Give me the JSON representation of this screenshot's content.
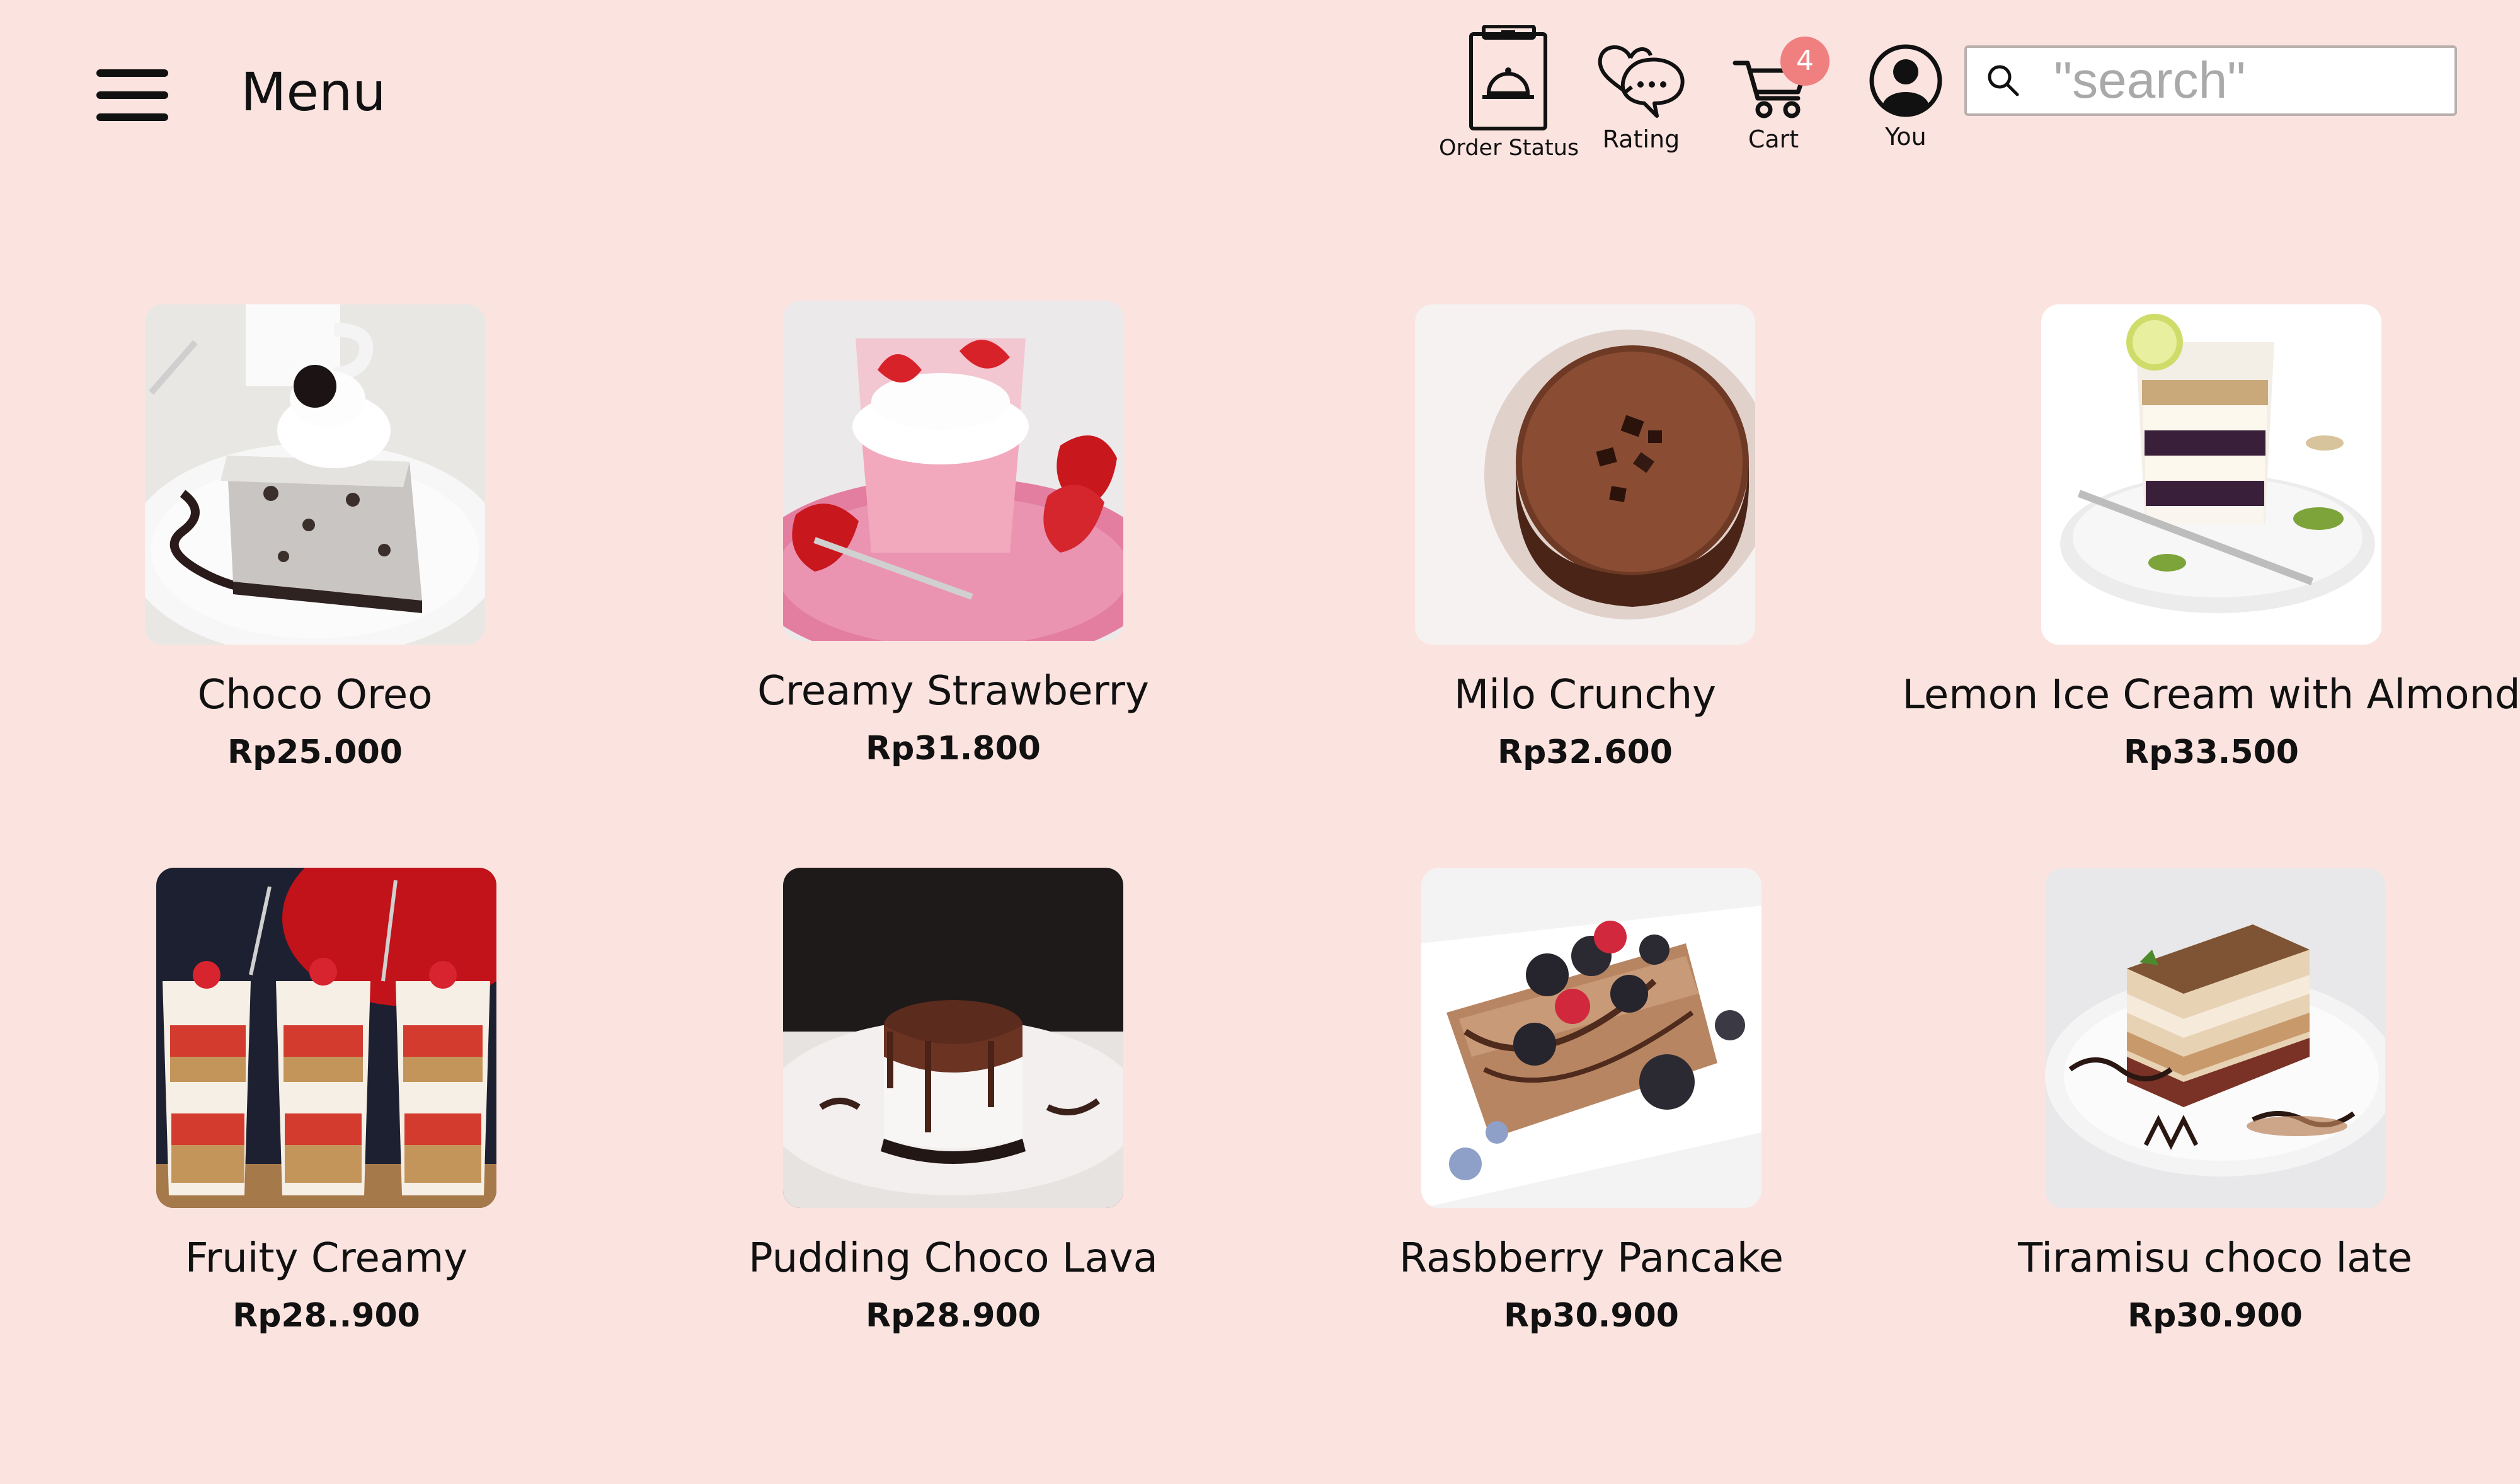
{
  "header": {
    "menu_title": "Menu",
    "nav": {
      "order_status": "Order Status",
      "rating": "Rating",
      "cart": "Cart",
      "cart_count": "4",
      "you": "You"
    },
    "search": {
      "placeholder": "\"search\""
    },
    "icons": [
      "hamburger-icon",
      "order-status-icon",
      "rating-icon",
      "cart-icon",
      "user-icon",
      "search-icon"
    ],
    "colors": {
      "background": "#fbe3df",
      "badge": "#f08080"
    }
  },
  "products": [
    {
      "name": "Choco Oreo",
      "price": "Rp25.000"
    },
    {
      "name": "Creamy Strawberry",
      "price": "Rp31.800"
    },
    {
      "name": "Milo Crunchy",
      "price": "Rp32.600"
    },
    {
      "name": "Lemon Ice Cream with Almond",
      "price": "Rp33.500"
    },
    {
      "name": "Fruity Creamy",
      "price": "Rp28..900"
    },
    {
      "name": "Pudding Choco Lava",
      "price": "Rp28.900"
    },
    {
      "name": "Rasbberry Pancake",
      "price": "Rp30.900"
    },
    {
      "name": "Tiramisu choco late",
      "price": "Rp30.900"
    }
  ]
}
